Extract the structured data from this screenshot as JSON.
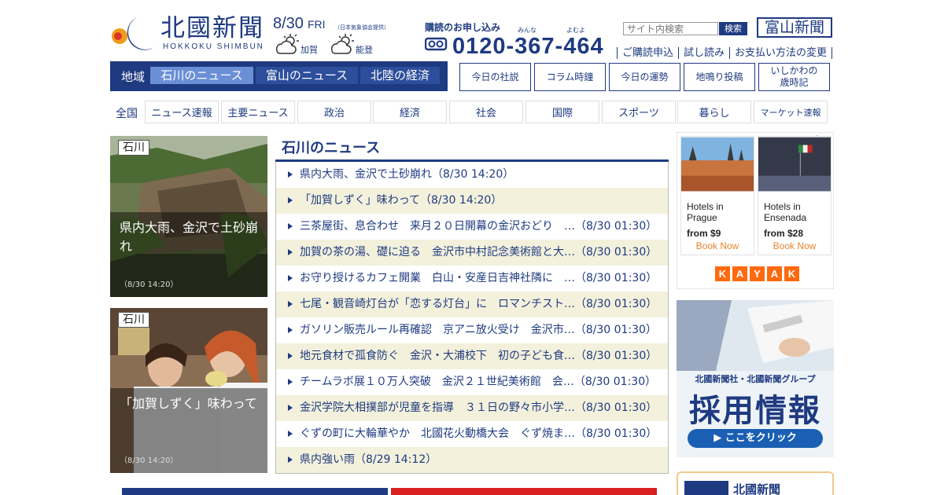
{
  "header": {
    "logo_text": "北國新聞",
    "logo_sub": "HOKKOKU SHIMBUN",
    "date": "8/30",
    "dow": "FRI",
    "date_note": "（日本気象協会提供）",
    "weather": [
      {
        "place": "加賀",
        "icon": "cloud-sun-icon"
      },
      {
        "place": "能登",
        "icon": "cloud-sun-icon"
      }
    ],
    "subscribe_title": "購読のお申し込み",
    "phone": "0120-367-464",
    "phone_ruby": [
      "みんな",
      "よむよ"
    ],
    "search_placeholder": "サイト内検索",
    "search_button": "検索",
    "toyama_button": "富山新聞",
    "top_links": [
      "ご購読申込",
      "試し読み",
      "お支払い方法の変更"
    ]
  },
  "region_nav": {
    "label": "地域",
    "tabs": [
      "石川のニュース",
      "富山のニュース",
      "北陸の経済"
    ]
  },
  "column_buttons": [
    "今日の社説",
    "コラム時鐘",
    "今日の運勢",
    "地鳴り投稿",
    "いしかわの\n歳時記"
  ],
  "category_nav": {
    "label": "全国",
    "items": [
      "ニュース速報",
      "主要ニュース",
      "政治",
      "経済",
      "社会",
      "国際",
      "スポーツ",
      "暮らし",
      "マーケット速報"
    ]
  },
  "featured": [
    {
      "tag": "石川",
      "title": "県内大雨、金沢で土砂崩れ",
      "time": "（8/30 14:20）"
    },
    {
      "tag": "石川",
      "title": "「加賀しずく」味わって",
      "time": "（8/30 14:20）"
    }
  ],
  "news": {
    "heading": "石川のニュース",
    "items": [
      "県内大雨、金沢で土砂崩れ（8/30 14:20）",
      "「加賀しずく」味わって（8/30 14:20）",
      "三茶屋街、息合わせ　来月２０日開幕の金沢おどり　…（8/30 01:30）",
      "加賀の茶の湯、礎に迫る　金沢市中村記念美術館と大…（8/30 01:30）",
      "お守り授けるカフェ開業　白山・安産日吉神社隣に　…（8/30 01:30）",
      "七尾・観音崎灯台が「恋する灯台」に　ロマンチスト…（8/30 01:30）",
      "ガソリン販売ルール再確認　京アニ放火受け　金沢市…（8/30 01:30）",
      "地元食材で孤食防ぐ　金沢・大浦校下　初の子ども食…（8/30 01:30）",
      "チームラボ展１０万人突破　金沢２１世紀美術館　会…（8/30 01:30）",
      "金沢学院大相撲部が児童を指導　３１日の野々市小学…（8/30 01:30）",
      "ぐずの町に大輪華やか　北國花火動橋大会　ぐず焼ま…（8/30 01:30）",
      "県内強い雨（8/29 14:12）"
    ]
  },
  "ads": {
    "hotel_cards": [
      {
        "line1": "Hotels in",
        "line2": "Prague",
        "price": "from $9",
        "button": "Book Now"
      },
      {
        "line1": "Hotels in",
        "line2": "Ensenada",
        "price": "from $28",
        "button": "Book Now"
      }
    ],
    "kayak_letters": [
      "K",
      "A",
      "Y",
      "A",
      "K"
    ],
    "recruit_sub": "北國新聞社・北國新聞グループ",
    "recruit_big": "採用情報",
    "recruit_cta": "▶ ここをクリック",
    "bottom_right_title": "北國新聞"
  },
  "colors": {
    "brand": "#1e3a80",
    "active_tab": "#6a8fd6",
    "alt_row": "#f3f1dc",
    "kayak": "#ff690f"
  }
}
